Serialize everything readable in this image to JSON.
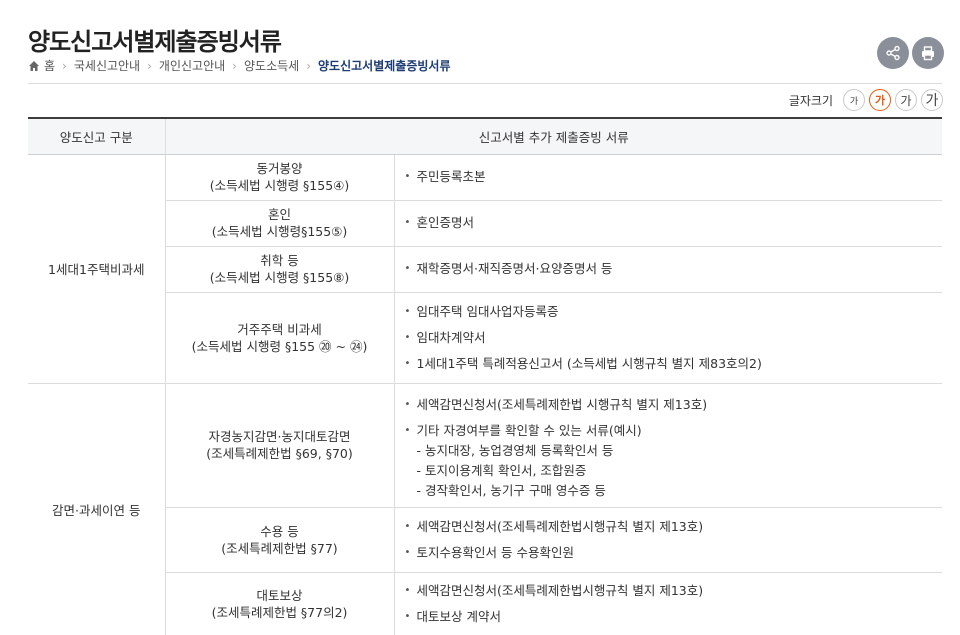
{
  "page": {
    "title": "양도신고서별제출증빙서류"
  },
  "breadcrumb": {
    "home": "홈",
    "items": [
      "국세신고안내",
      "개인신고안내",
      "양도소득세"
    ],
    "current": "양도신고서별제출증빙서류"
  },
  "fontsize": {
    "label": "글자크기",
    "options": [
      "가",
      "가",
      "가",
      "가"
    ]
  },
  "table": {
    "headers": [
      "양도신고 구분",
      "신고서별 추가 제출증빙 서류"
    ],
    "groups": [
      {
        "category": "1세대1주택비과세",
        "rows": [
          {
            "title": "동거봉양",
            "law": "(소득세법 시행령 §155④)",
            "docs": [
              "주민등록초본"
            ]
          },
          {
            "title": "혼인",
            "law": "(소득세법 시행령§155⑤)",
            "docs": [
              "혼인증명서"
            ]
          },
          {
            "title": "취학 등",
            "law": "(소득세법 시행령 §155⑧)",
            "docs": [
              "재학증명서·재직증명서·요양증명서 등"
            ]
          },
          {
            "title": "거주주택 비과세",
            "law": "(소득세법 시행령 §155 ⑳ ~ ㉔)",
            "docs": [
              "임대주택 임대사업자등록증",
              "임대차계약서",
              "1세대1주택 특례적용신고서 (소득세법 시행규칙 별지 제83호의2)"
            ]
          }
        ]
      },
      {
        "category": "감면·과세이연 등",
        "rows": [
          {
            "title": "자경농지감면·농지대토감면",
            "law": "(조세특례제한법 §69, §70)",
            "docs": [
              "세액감면신청서(조세특례제한법 시행규칙 별지 제13호)",
              "기타 자경여부를 확인할 수 있는 서류(예시)"
            ],
            "subdocs": [
              "- 농지대장, 농업경영체 등록확인서 등",
              "- 토지이용계획 확인서, 조합원증",
              "- 경작확인서, 농기구 구매 영수증 등"
            ]
          },
          {
            "title": "수용 등",
            "law": "(조세특례제한법 §77)",
            "docs": [
              "세액감면신청서(조세특례제한법시행규칙 별지 제13호)",
              "토지수용확인서 등 수용확인원"
            ]
          },
          {
            "title": "대토보상",
            "law": "(조세특례제한법 §77의2)",
            "docs": [
              "세액감면신청서(조세특례제한법시행규칙 별지 제13호)",
              "대토보상 계약서"
            ]
          }
        ]
      }
    ]
  }
}
